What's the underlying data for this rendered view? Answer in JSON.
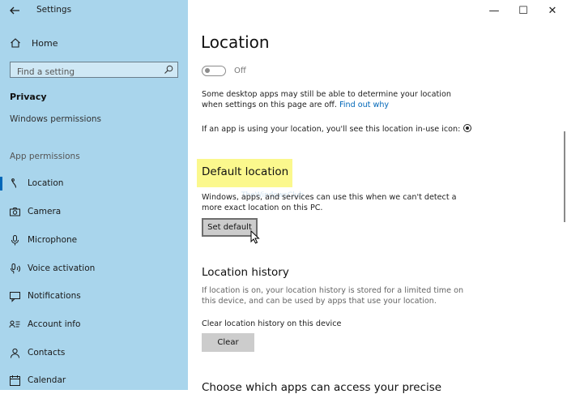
{
  "window": {
    "title": "Settings",
    "minimize_glyph": "—",
    "maximize_glyph": "☐",
    "close_glyph": "✕"
  },
  "sidebar": {
    "home_label": "Home",
    "search_placeholder": "Find a setting",
    "category_heading": "Privacy",
    "windows_permissions_label": "Windows permissions",
    "app_permissions_label": "App permissions",
    "items": [
      {
        "label": "Location",
        "icon": "location-icon",
        "active": true
      },
      {
        "label": "Camera",
        "icon": "camera-icon"
      },
      {
        "label": "Microphone",
        "icon": "microphone-icon"
      },
      {
        "label": "Voice activation",
        "icon": "voice-activation-icon"
      },
      {
        "label": "Notifications",
        "icon": "notifications-icon"
      },
      {
        "label": "Account info",
        "icon": "account-info-icon"
      },
      {
        "label": "Contacts",
        "icon": "contacts-icon"
      },
      {
        "label": "Calendar",
        "icon": "calendar-icon"
      }
    ]
  },
  "main": {
    "page_title": "Location",
    "toggle_state": "Off",
    "desktop_apps_text": "Some desktop apps may still be able to determine your location when settings on this page are off.",
    "find_out_why": "Find out why",
    "in_use_text": "If an app is using your location, you'll see this location in-use icon:",
    "default_location": {
      "title": "Default location",
      "description": "Windows, apps, and services can use this when we can't detect a more exact location on this PC.",
      "button_label": "Set default"
    },
    "location_history": {
      "title": "Location history",
      "description": "If location is on, your location history is stored for a limited time on this device, and can be used by apps that use your location.",
      "clear_label_text": "Clear location history on this device",
      "button_label": "Clear"
    },
    "next_section_title": "Choose which apps can access your precise",
    "watermark": "TheWindowsClub"
  },
  "colors": {
    "sidebar_bg": "#a9d5ec",
    "accent": "#0067b8",
    "highlight": "#fbf88d",
    "button_bg": "#cccccc"
  }
}
